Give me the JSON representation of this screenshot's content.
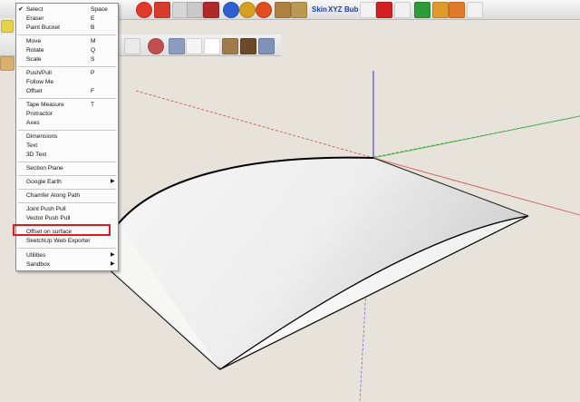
{
  "toolbar": {
    "skin_label": "Skin",
    "xyz_label": "XYZ",
    "bub_label": "Bub"
  },
  "menu": {
    "items": [
      {
        "label": "Select",
        "shortcut": "Space",
        "checked": true
      },
      {
        "label": "Eraser",
        "shortcut": "E"
      },
      {
        "label": "Paint Bucket",
        "shortcut": "B"
      },
      {
        "label": "Move",
        "shortcut": "M"
      },
      {
        "label": "Rotate",
        "shortcut": "Q"
      },
      {
        "label": "Scale",
        "shortcut": "S"
      },
      {
        "label": "Push/Pull",
        "shortcut": "P"
      },
      {
        "label": "Follow Me"
      },
      {
        "label": "Offset",
        "shortcut": "F"
      },
      {
        "label": "Tape Measure",
        "shortcut": "T"
      },
      {
        "label": "Protractor"
      },
      {
        "label": "Axes"
      },
      {
        "label": "Dimensions"
      },
      {
        "label": "Text"
      },
      {
        "label": "3D Text"
      },
      {
        "label": "Section Plane"
      },
      {
        "label": "Google Earth",
        "submenu": true
      },
      {
        "label": "Chamfer Along Path"
      },
      {
        "label": "Joint Push Pull"
      },
      {
        "label": "Vector Push Pull"
      },
      {
        "label": "Offset on surface",
        "highlighted": true
      },
      {
        "label": "SketchUp Web Exporter"
      },
      {
        "label": "Utilities",
        "submenu": true
      },
      {
        "label": "Sandbox",
        "submenu": true
      }
    ]
  },
  "colors": {
    "highlight": "#e11b1b",
    "ground": "#e8e3da",
    "axis_red": "#d24a4a",
    "axis_green": "#3fa83f",
    "axis_blue": "#2b2bd6"
  }
}
